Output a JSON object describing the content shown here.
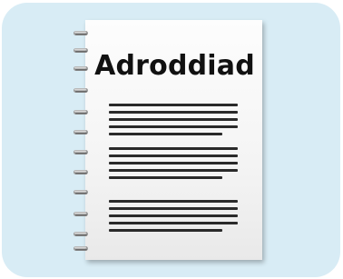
{
  "notebook": {
    "title": "Adroddiad",
    "text_blocks": [
      {
        "lines": 5
      },
      {
        "lines": 5
      },
      {
        "lines": 5
      }
    ]
  },
  "colors": {
    "background_tile": "#d8ecf5",
    "paper": "#f8f8f8",
    "text": "#111111",
    "lines": "#2a2a2a"
  },
  "icon": "spiral-notebook-icon"
}
